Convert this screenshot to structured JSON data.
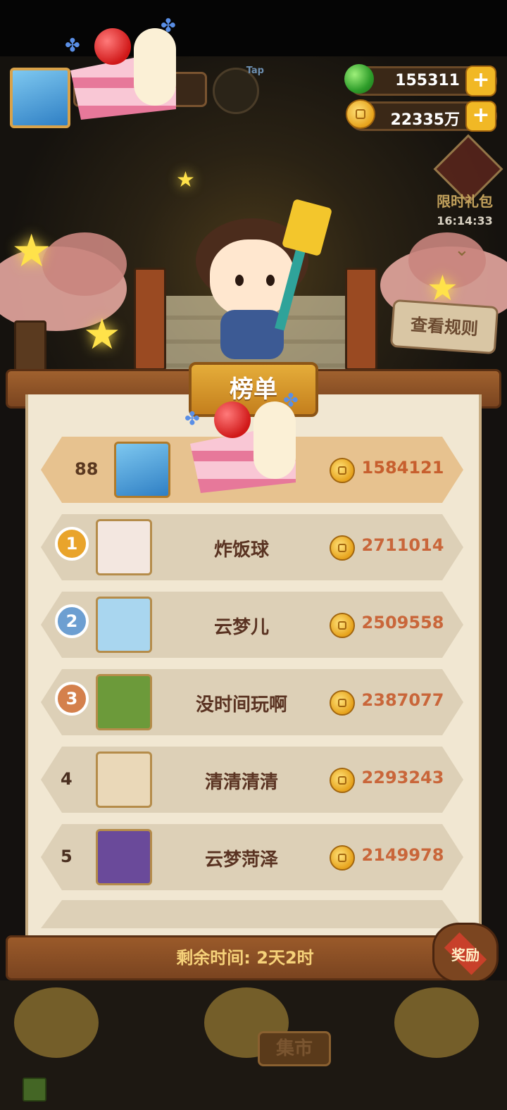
{
  "tap_label": "Tap",
  "currency": {
    "gems": "155311",
    "coins": "22335万",
    "plus": "+"
  },
  "gift": {
    "title": "限时礼包",
    "timer": "16:14:33"
  },
  "rules_button": "查看规则",
  "board_title": "榜单",
  "my_rank": {
    "rank": "88",
    "name": "",
    "score": "1584121"
  },
  "rankings": [
    {
      "rank": "1",
      "name": "炸饭球",
      "score": "2711014",
      "medal": "gold"
    },
    {
      "rank": "2",
      "name": "云梦儿",
      "score": "2509558",
      "medal": "silver"
    },
    {
      "rank": "3",
      "name": "没时间玩啊",
      "score": "2387077",
      "medal": "bronze"
    },
    {
      "rank": "4",
      "name": "清清清清",
      "score": "2293243",
      "medal": ""
    },
    {
      "rank": "5",
      "name": "云梦菏泽",
      "score": "2149978",
      "medal": ""
    }
  ],
  "remaining_time": "剩余时间: 2天2时",
  "reward_label": "奖励",
  "market_label": "集市",
  "colors": {
    "accent_gold": "#e5ad3a",
    "score_text": "#c9663a",
    "panel_bg": "#f1e7d2"
  }
}
